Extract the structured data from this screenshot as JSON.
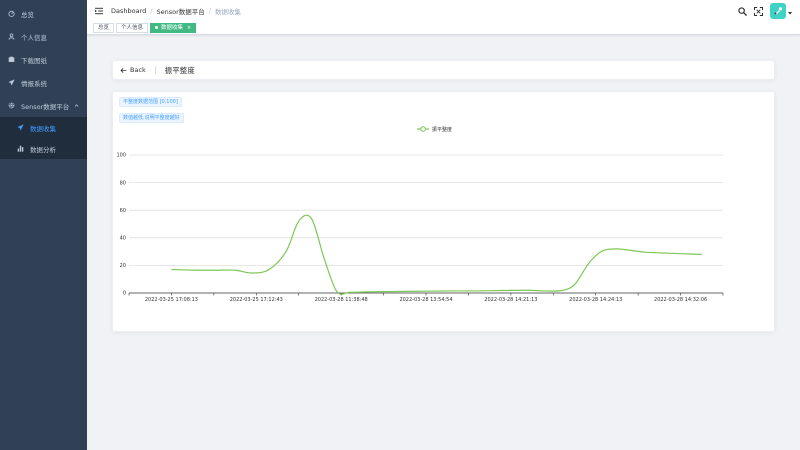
{
  "sidebar": {
    "items": [
      {
        "label": "总览",
        "icon": "dashboard-icon"
      },
      {
        "label": "个人信息",
        "icon": "user-icon"
      },
      {
        "label": "下载图纸",
        "icon": "download-icon"
      },
      {
        "label": "情报系统",
        "icon": "send-icon"
      }
    ],
    "submenu": {
      "label": "Sensor数据平台",
      "icon": "gear-icon",
      "children": [
        {
          "label": "数据收集",
          "icon": "send-icon",
          "active": true
        },
        {
          "label": "数据分析",
          "icon": "bar-chart-icon",
          "active": false
        }
      ]
    },
    "colors": {
      "bg": "#304156",
      "text": "#bfcbd9",
      "active": "#409eff",
      "submenu_bg": "#1f2d3d"
    }
  },
  "navbar": {
    "breadcrumb": [
      "Dashboard",
      "Sensor数据平台",
      "数据收集"
    ]
  },
  "tags": [
    {
      "label": "总览",
      "active": false
    },
    {
      "label": "个人信息",
      "active": false
    },
    {
      "label": "数据收集",
      "active": true
    }
  ],
  "page_header": {
    "back_label": "Back",
    "title": "振平整度"
  },
  "info_tags": [
    "平整度数据范围 [0,100]",
    "数值越低,说明平整度越好"
  ],
  "chart_data": {
    "type": "line",
    "legend": [
      "振平整度"
    ],
    "legend_position": "top-center",
    "color": "#7dc855",
    "ylim": [
      0,
      100
    ],
    "yticks": [
      0,
      20,
      40,
      60,
      80,
      100
    ],
    "grid": true,
    "x_tick_labels": [
      "2022-03-25 17:08:13",
      "2022-03-25 17:12:43",
      "2022-03-28 11:38:48",
      "2022-03-28 13:54:54",
      "2022-03-28 14:21:13",
      "2022-03-28 14:24:13",
      "2022-03-28 14:32:06"
    ],
    "series": [
      {
        "name": "振平整度",
        "x": [
          0,
          0.3,
          0.5,
          0.75,
          0.95,
          1.15,
          1.35,
          1.5,
          1.65,
          1.8,
          1.95,
          2.1,
          2.3,
          2.5,
          2.8,
          3.0,
          3.3,
          3.6,
          3.9,
          4.2,
          4.4,
          4.6,
          4.75,
          4.9,
          5.0,
          5.1,
          5.25,
          5.4,
          5.6,
          5.8,
          6.0,
          6.25
        ],
        "values": [
          17,
          16.5,
          16.5,
          16.5,
          14.5,
          17,
          30,
          52,
          54,
          25,
          1,
          0.5,
          0.8,
          1,
          1.2,
          1.3,
          1.5,
          1.5,
          1.8,
          2,
          1.5,
          1.8,
          6,
          20,
          27,
          31,
          32,
          31,
          29.5,
          29,
          28.5,
          28
        ]
      }
    ]
  }
}
